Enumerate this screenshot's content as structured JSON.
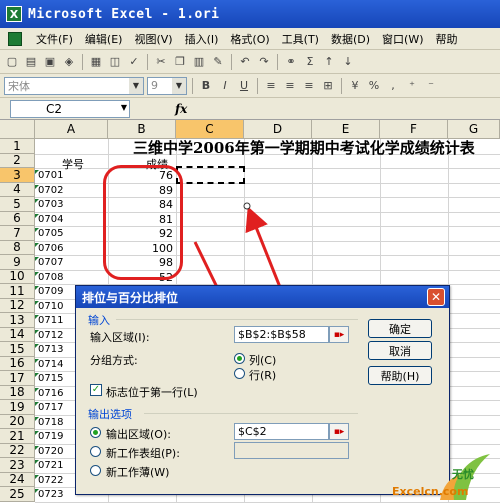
{
  "window": {
    "title": "Microsoft Excel - 1.ori",
    "app_icon": "X"
  },
  "menu": [
    {
      "label": "文件(F)"
    },
    {
      "label": "编辑(E)"
    },
    {
      "label": "视图(V)"
    },
    {
      "label": "插入(I)"
    },
    {
      "label": "格式(O)"
    },
    {
      "label": "工具(T)"
    },
    {
      "label": "数据(D)"
    },
    {
      "label": "窗口(W)"
    },
    {
      "label": "帮助"
    }
  ],
  "toolbar2": {
    "font": "宋体",
    "size": "9",
    "zoom": "%"
  },
  "formula_bar": {
    "name_box": "C2",
    "fx": "fx"
  },
  "sheet": {
    "columns": [
      "A",
      "B",
      "C",
      "D",
      "E",
      "F",
      "G"
    ],
    "rows": [
      "1",
      "2",
      "3",
      "4",
      "5",
      "6",
      "7",
      "8",
      "9",
      "10",
      "11",
      "12",
      "13",
      "14",
      "15",
      "16",
      "17",
      "18",
      "19",
      "20",
      "21",
      "22",
      "23",
      "24",
      "25"
    ],
    "title": "三维中学2006年第一学期期中考试化学成绩统计表",
    "col_a_header": "学号",
    "col_b_header": "成绩",
    "ids": [
      "0701",
      "0702",
      "0703",
      "0704",
      "0705",
      "0706",
      "0707",
      "0708",
      "0709",
      "0710",
      "0711",
      "0712",
      "0713",
      "0714",
      "0715",
      "0716",
      "0717",
      "0718",
      "0719",
      "0720",
      "0721",
      "0722",
      "0723"
    ],
    "scores": [
      "76",
      "89",
      "84",
      "81",
      "92",
      "100",
      "98",
      "52"
    ]
  },
  "dialog": {
    "title": "排位与百分比排位",
    "close": "✕",
    "input_group": "输入",
    "input_range_label": "输入区域(I):",
    "input_range_value": "$B$2:$B$58",
    "group_by_label": "分组方式:",
    "group_column": "列(C)",
    "group_row": "行(R)",
    "labels_first_row": "标志位于第一行(L)",
    "output_group": "输出选项",
    "output_range_label": "输出区域(O):",
    "output_range_value": "$C$2",
    "new_sheet_label": "新工作表组(P):",
    "new_workbook_label": "新工作薄(W)",
    "ok": "确定",
    "cancel": "取消",
    "help": "帮助(H)"
  },
  "watermark": {
    "brand": "Excelcn.com",
    "cn": "无忧"
  },
  "colors": {
    "annotation": "#e02020",
    "selected_header": "#f8c56b",
    "title_bar": "#1646b8"
  }
}
